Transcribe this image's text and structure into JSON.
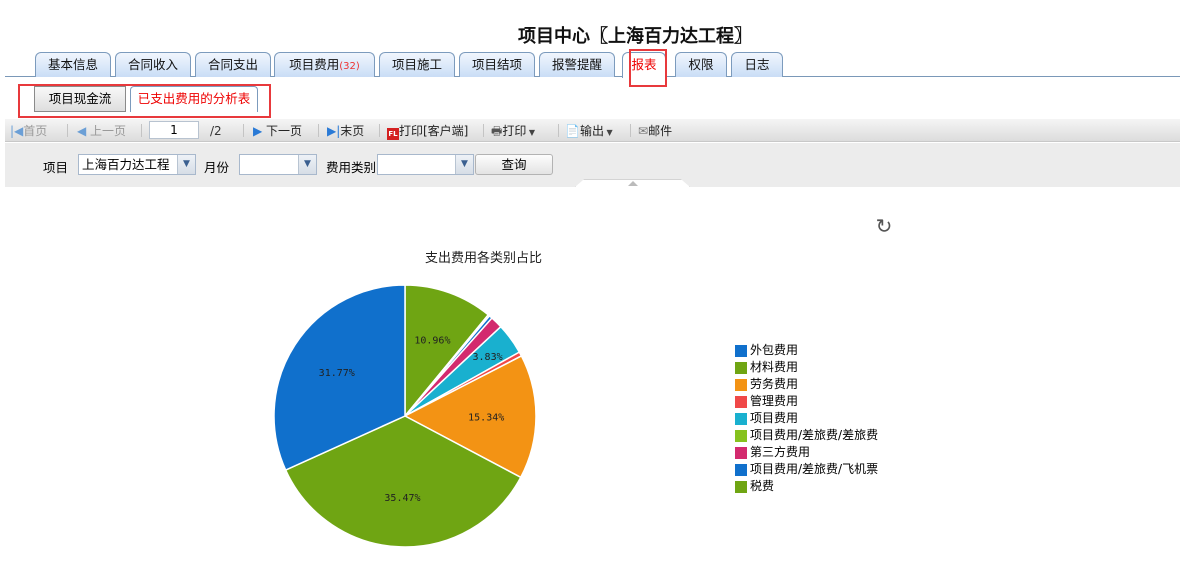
{
  "header": {
    "title": "项目中心〖上海百力达工程〗"
  },
  "tabs": [
    {
      "label": "基本信息"
    },
    {
      "label": "合同收入"
    },
    {
      "label": "合同支出"
    },
    {
      "label": "项目费用",
      "count": "(32)"
    },
    {
      "label": "项目施工"
    },
    {
      "label": "项目结项"
    },
    {
      "label": "报警提醒"
    },
    {
      "label": "报表",
      "active": true
    },
    {
      "label": "权限"
    },
    {
      "label": "日志"
    }
  ],
  "subtabs": [
    {
      "label": "项目现金流"
    },
    {
      "label": "已支出费用的分析表",
      "active": true
    }
  ],
  "toolbar": {
    "first": "首页",
    "prev": "上一页",
    "page": "1",
    "total_pages": "/2",
    "next": "下一页",
    "last": "末页",
    "print_client": "打印[客户端]",
    "print": "打印",
    "export": "输出",
    "mail": "邮件"
  },
  "filters": {
    "project_label": "项目",
    "project_value": "上海百力达工程",
    "month_label": "月份",
    "month_value": "",
    "category_label": "费用类别",
    "category_value": "",
    "query_button": "查询"
  },
  "chart_data": {
    "type": "pie",
    "title": "支出费用各类别占比",
    "legend_position": "right",
    "slices": [
      {
        "name": "税费",
        "value": 10.96,
        "label": "10.96%",
        "color": "#6fa513"
      },
      {
        "name": "项目费用/差旅费/差旅费",
        "value": 0.2,
        "label": "",
        "color": "#86c21e"
      },
      {
        "name": "项目费用/差旅费/飞机票",
        "value": 0.4,
        "label": "",
        "color": "#1070cc"
      },
      {
        "name": "第三方费用",
        "value": 1.5,
        "label": "",
        "color": "#d32a6e"
      },
      {
        "name": "项目费用",
        "value": 3.83,
        "label": "3.83%",
        "color": "#19b0cf"
      },
      {
        "name": "管理费用",
        "value": 0.53,
        "label": "",
        "color": "#f04848"
      },
      {
        "name": "劳务费用",
        "value": 15.34,
        "label": "15.34%",
        "color": "#f39314"
      },
      {
        "name": "材料费用",
        "value": 35.47,
        "label": "35.47%",
        "color": "#6fa513"
      },
      {
        "name": "外包费用",
        "value": 31.77,
        "label": "31.77%",
        "color": "#1070cc"
      }
    ],
    "legend": [
      {
        "name": "外包费用",
        "color": "#1070cc"
      },
      {
        "name": "材料费用",
        "color": "#6fa513"
      },
      {
        "name": "劳务费用",
        "color": "#f39314"
      },
      {
        "name": "管理费用",
        "color": "#f04848"
      },
      {
        "name": "项目费用",
        "color": "#19b0cf"
      },
      {
        "name": "项目费用/差旅费/差旅费",
        "color": "#86c21e"
      },
      {
        "name": "第三方费用",
        "color": "#d32a6e"
      },
      {
        "name": "项目费用/差旅费/飞机票",
        "color": "#1070cc"
      },
      {
        "name": "税费",
        "color": "#6fa513"
      }
    ]
  }
}
